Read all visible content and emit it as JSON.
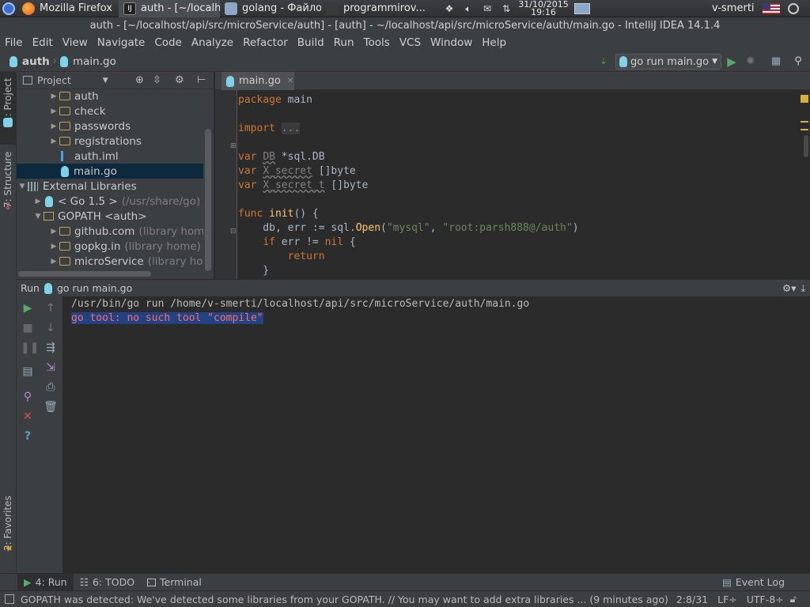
{
  "os_panel": {
    "tasks": [
      {
        "label": "Mozilla Firefox",
        "icon": "firefox-icon"
      },
      {
        "label": "auth - [~/localh...",
        "icon": "intellij-icon"
      },
      {
        "label": "golang - Файло...",
        "icon": "folder-icon"
      },
      {
        "label": "programmirov...",
        "icon": "chat-icon"
      }
    ],
    "clock_date": "31/10/2015",
    "clock_time": "19:16",
    "user": "v-smerti"
  },
  "window_title": "auth - [~/localhost/api/src/microService/auth] - [auth] - ~/localhost/api/src/microService/auth/main.go - IntelliJ IDEA 14.1.4",
  "menu": [
    "File",
    "Edit",
    "View",
    "Navigate",
    "Code",
    "Analyze",
    "Refactor",
    "Build",
    "Run",
    "Tools",
    "VCS",
    "Window",
    "Help"
  ],
  "navbar": {
    "crumb_project": "auth",
    "crumb_file": "main.go",
    "run_config": "go run main.go"
  },
  "left_strip": {
    "project_tab": "1: Project",
    "structure_tab": "7: Structure",
    "favorites_tab": "2: Favorites"
  },
  "project_panel": {
    "header": "Project",
    "rows": [
      {
        "label": "auth",
        "hint": "",
        "kind": "folder",
        "expanded": false,
        "depth": 2
      },
      {
        "label": "check",
        "hint": "",
        "kind": "folder",
        "expanded": false,
        "depth": 2
      },
      {
        "label": "passwords",
        "hint": "",
        "kind": "folder",
        "expanded": false,
        "depth": 2
      },
      {
        "label": "registrations",
        "hint": "",
        "kind": "folder",
        "expanded": false,
        "depth": 2
      },
      {
        "label": "auth.iml",
        "hint": "",
        "kind": "iml",
        "expanded": null,
        "depth": 2
      },
      {
        "label": "main.go",
        "hint": "",
        "kind": "go",
        "expanded": null,
        "depth": 2,
        "selected": true
      },
      {
        "label": "External Libraries",
        "hint": "",
        "kind": "libs",
        "expanded": true,
        "depth": 0
      },
      {
        "label": "< Go 1.5 >",
        "hint": "(/usr/share/go)",
        "kind": "go",
        "expanded": false,
        "depth": 1
      },
      {
        "label": "GOPATH <auth>",
        "hint": "",
        "kind": "lib",
        "expanded": true,
        "depth": 1
      },
      {
        "label": "github.com",
        "hint": "(library home)",
        "kind": "folder",
        "expanded": false,
        "depth": 2
      },
      {
        "label": "gopkg.in",
        "hint": "(library home)",
        "kind": "folder",
        "expanded": false,
        "depth": 2
      },
      {
        "label": "microService",
        "hint": "(library home)",
        "kind": "folder",
        "expanded": false,
        "depth": 2
      }
    ]
  },
  "editor": {
    "tab_label": "main.go",
    "lines": [
      [
        {
          "t": "package",
          "c": "kw"
        },
        {
          "t": " main",
          "c": ""
        }
      ],
      [],
      [
        {
          "t": "import",
          "c": "kw"
        },
        {
          "t": " ",
          "c": ""
        },
        {
          "t": "...",
          "c": "fold"
        }
      ],
      [],
      [
        {
          "t": "var",
          "c": "kw"
        },
        {
          "t": " ",
          "c": ""
        },
        {
          "t": "DB",
          "c": "dim squig"
        },
        {
          "t": " *sql.DB",
          "c": ""
        }
      ],
      [
        {
          "t": "var",
          "c": "kw"
        },
        {
          "t": " ",
          "c": ""
        },
        {
          "t": "X_secret",
          "c": "dim squig"
        },
        {
          "t": " []byte",
          "c": ""
        }
      ],
      [
        {
          "t": "var",
          "c": "kw"
        },
        {
          "t": " ",
          "c": ""
        },
        {
          "t": "X_secret_t",
          "c": "dim squig"
        },
        {
          "t": " []byte",
          "c": ""
        }
      ],
      [],
      [
        {
          "t": "func",
          "c": "kw"
        },
        {
          "t": " ",
          "c": ""
        },
        {
          "t": "init",
          "c": "fn"
        },
        {
          "t": "() {",
          "c": ""
        }
      ],
      [
        {
          "t": "    db, err := sql.",
          "c": ""
        },
        {
          "t": "Open",
          "c": "fn"
        },
        {
          "t": "(",
          "c": ""
        },
        {
          "t": "\"mysql\"",
          "c": "str"
        },
        {
          "t": ", ",
          "c": ""
        },
        {
          "t": "\"root:parsh888@/auth\"",
          "c": "str"
        },
        {
          "t": ")",
          "c": ""
        }
      ],
      [
        {
          "t": "    ",
          "c": ""
        },
        {
          "t": "if",
          "c": "kw"
        },
        {
          "t": " err != ",
          "c": ""
        },
        {
          "t": "nil",
          "c": "kw"
        },
        {
          "t": " {",
          "c": ""
        }
      ],
      [
        {
          "t": "        ",
          "c": ""
        },
        {
          "t": "return",
          "c": "kw"
        }
      ],
      [
        {
          "t": "    }",
          "c": ""
        }
      ]
    ]
  },
  "run_panel": {
    "label": "Run",
    "config": "go run main.go",
    "console": [
      {
        "text": "/usr/bin/go run /home/v-smerti/localhost/api/src/microService/auth/main.go",
        "error": false
      },
      {
        "text": "go tool: no such tool \"compile\"",
        "error": true
      }
    ]
  },
  "bottom_tabs": {
    "run": "4: Run",
    "todo": "6: TODO",
    "terminal": "Terminal",
    "event_log": "Event Log"
  },
  "statusbar": {
    "message": "GOPATH was detected: We've detected some libraries from your GOPATH. // You may want to add extra libraries ... (9 minutes ago)",
    "position": "2:8/31",
    "line_sep": "LF÷",
    "encoding": "UTF-8÷"
  },
  "colors": {
    "keyword": "#cc7832",
    "string": "#6a8759",
    "function": "#ffc66d",
    "error": "#ff6b68",
    "selection": "#0d293e"
  }
}
